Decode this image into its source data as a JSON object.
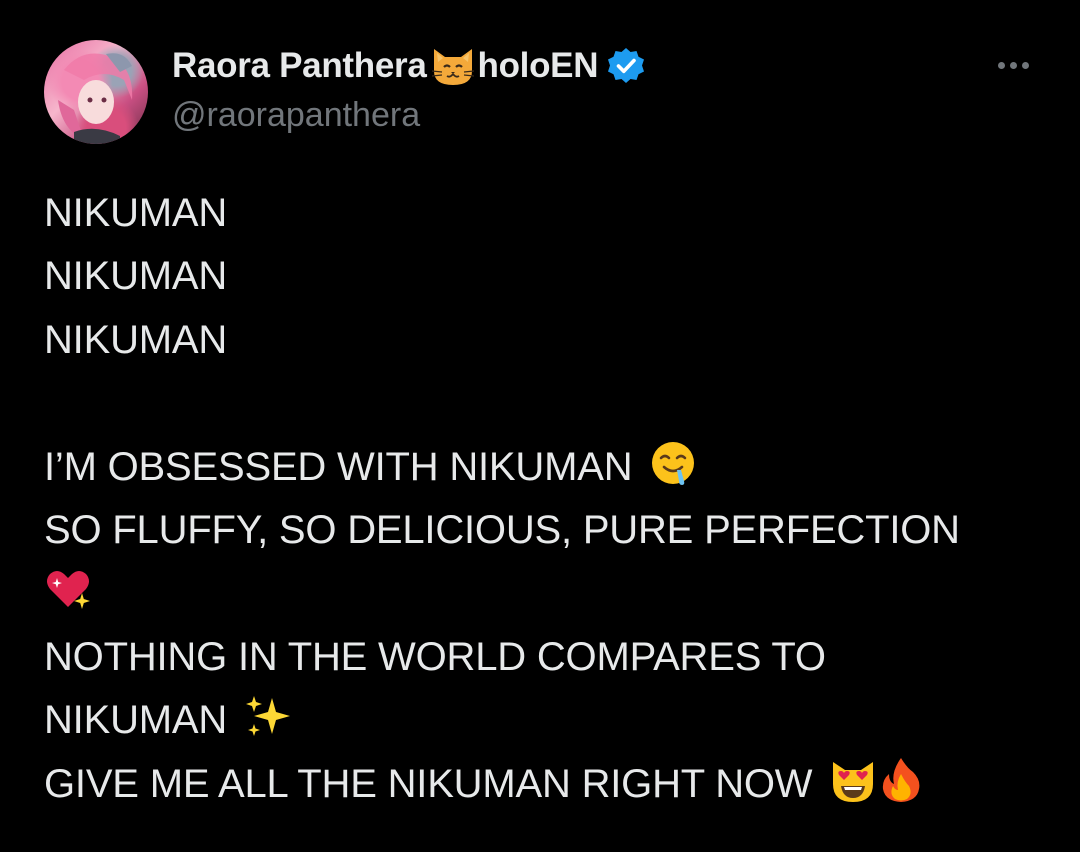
{
  "author": {
    "display_name_part1": "Raora Panthera",
    "display_name_part2": "holoEN",
    "handle": "@raorapanthera",
    "name_icon": "cat-face-icon",
    "verified_icon": "verified-badge-icon",
    "verified_color": "#1d9bf0"
  },
  "menu": {
    "more_icon": "more-options-icon"
  },
  "tweet": {
    "line1": "NIKUMAN",
    "line2": "NIKUMAN",
    "line3": "NIKUMAN",
    "line4": "I’M OBSESSED WITH NIKUMAN",
    "line4_emoji": "drooling-face-icon",
    "line5": "SO FLUFFY, SO DELICIOUS, PURE PERFECTION",
    "line6_emoji": "sparkling-heart-icon",
    "line7": "NOTHING IN THE WORLD COMPARES TO",
    "line8": "NIKUMAN",
    "line8_emoji": "sparkles-icon",
    "line9": "GIVE ME ALL THE NIKUMAN RIGHT NOW",
    "line9_emojis": [
      "smiling-cat-heart-eyes-icon",
      "fire-icon"
    ]
  },
  "colors": {
    "background": "#000000",
    "text": "#e7e9ea",
    "secondary_text": "#71767b"
  }
}
